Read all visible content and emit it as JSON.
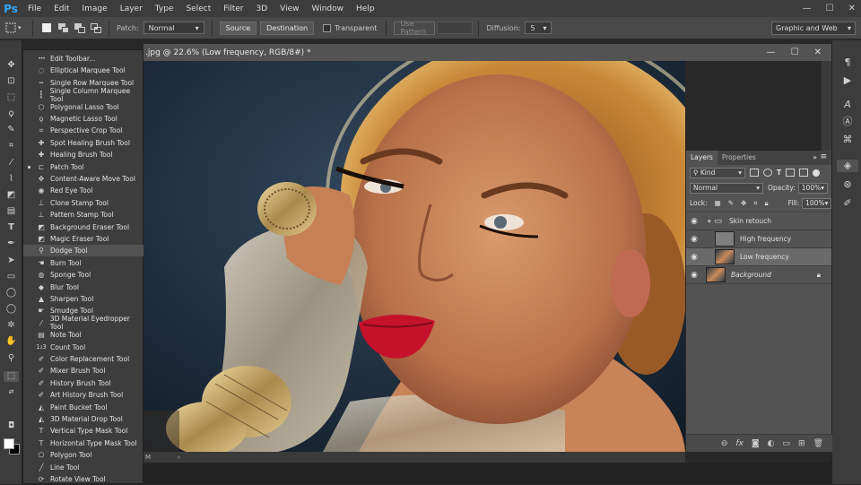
{
  "app": {
    "logo": "Ps"
  },
  "menu": [
    "File",
    "Edit",
    "Image",
    "Layer",
    "Type",
    "Select",
    "Filter",
    "3D",
    "View",
    "Window",
    "Help"
  ],
  "window_controls": {
    "minimize": "—",
    "maximize": "☐",
    "close": "✕"
  },
  "options_bar": {
    "patch_label": "Patch:",
    "patch_mode": "Normal",
    "source": "Source",
    "destination": "Destination",
    "transparent": "Transparent",
    "use_pattern": "Use Pattern",
    "diffusion_label": "Diffusion:",
    "diffusion_value": "5",
    "workspace": "Graphic and Web"
  },
  "document": {
    "tab_title": ".jpg @ 22.6% (Low frequency, RGB/8#) *",
    "status": "M",
    "controls": {
      "minimize": "—",
      "maximize": "☐",
      "close": "✕"
    }
  },
  "tool_flyout": {
    "selected_index": 16,
    "active_index": 16,
    "items": [
      {
        "label": "Edit Toolbar...",
        "icon": "dots-icon"
      },
      {
        "label": "Elliptical Marquee Tool",
        "icon": "ellipse-marquee-icon"
      },
      {
        "label": "Single Row Marquee Tool",
        "icon": "row-marquee-icon"
      },
      {
        "label": "Single Column Marquee Tool",
        "icon": "column-marquee-icon"
      },
      {
        "label": "Polygonal Lasso Tool",
        "icon": "polygon-lasso-icon"
      },
      {
        "label": "Magnetic Lasso Tool",
        "icon": "magnetic-lasso-icon"
      },
      {
        "label": "Perspective Crop Tool",
        "icon": "perspective-crop-icon"
      },
      {
        "label": "Spot Healing Brush Tool",
        "icon": "spot-healing-icon"
      },
      {
        "label": "Healing Brush Tool",
        "icon": "healing-brush-icon"
      },
      {
        "label": "Patch Tool",
        "icon": "patch-icon"
      },
      {
        "label": "Content-Aware Move Tool",
        "icon": "content-aware-move-icon"
      },
      {
        "label": "Red Eye Tool",
        "icon": "red-eye-icon"
      },
      {
        "label": "Clone Stamp Tool",
        "icon": "clone-stamp-icon"
      },
      {
        "label": "Pattern Stamp Tool",
        "icon": "pattern-stamp-icon"
      },
      {
        "label": "Background Eraser Tool",
        "icon": "background-eraser-icon"
      },
      {
        "label": "Magic Eraser Tool",
        "icon": "magic-eraser-icon"
      },
      {
        "label": "Dodge Tool",
        "icon": "dodge-icon"
      },
      {
        "label": "Burn Tool",
        "icon": "burn-icon"
      },
      {
        "label": "Sponge Tool",
        "icon": "sponge-icon"
      },
      {
        "label": "Blur Tool",
        "icon": "blur-icon"
      },
      {
        "label": "Sharpen Tool",
        "icon": "sharpen-icon"
      },
      {
        "label": "Smudge Tool",
        "icon": "smudge-icon"
      },
      {
        "label": "3D Material Eyedropper Tool",
        "icon": "material-eyedropper-icon"
      },
      {
        "label": "Note Tool",
        "icon": "note-icon"
      },
      {
        "label": "Count Tool",
        "icon": "count-icon"
      },
      {
        "label": "Color Replacement Tool",
        "icon": "color-replacement-icon"
      },
      {
        "label": "Mixer Brush Tool",
        "icon": "mixer-brush-icon"
      },
      {
        "label": "History Brush Tool",
        "icon": "history-brush-icon"
      },
      {
        "label": "Art History Brush Tool",
        "icon": "art-history-brush-icon"
      },
      {
        "label": "Paint Bucket Tool",
        "icon": "paint-bucket-icon"
      },
      {
        "label": "3D Material Drop Tool",
        "icon": "material-drop-icon"
      },
      {
        "label": "Vertical Type Mask Tool",
        "icon": "vertical-type-mask-icon"
      },
      {
        "label": "Horizontal Type Mask Tool",
        "icon": "horizontal-type-mask-icon"
      },
      {
        "label": "Polygon Tool",
        "icon": "polygon-icon"
      },
      {
        "label": "Line Tool",
        "icon": "line-icon"
      },
      {
        "label": "Rotate View Tool",
        "icon": "rotate-view-icon"
      }
    ]
  },
  "layers_panel": {
    "tabs": [
      "Layers",
      "Properties"
    ],
    "kind": "Kind",
    "blend_mode": "Normal",
    "opacity_label": "Opacity:",
    "opacity": "100%",
    "lock_label": "Lock:",
    "fill_label": "Fill:",
    "fill": "100%",
    "layers": [
      {
        "name": "Skin retouch",
        "type": "group"
      },
      {
        "name": "High frequency",
        "type": "layer"
      },
      {
        "name": "Low frequency",
        "type": "layer",
        "selected": true
      },
      {
        "name": "Background",
        "type": "background",
        "locked": true
      }
    ]
  }
}
